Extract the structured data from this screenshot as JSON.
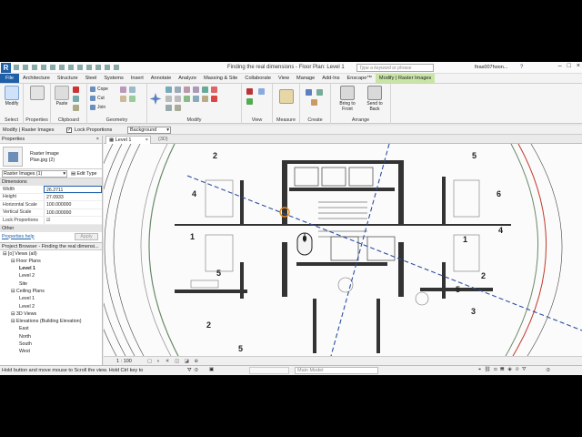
{
  "app": {
    "logo": "R",
    "title": "Finding the real dimensions - Floor Plan: Level 1",
    "search_placeholder": "Type a keyword or phrase",
    "user": "firas007hoon...",
    "help": "?"
  },
  "tabs": [
    "File",
    "Architecture",
    "Structure",
    "Steel",
    "Systems",
    "Insert",
    "Annotate",
    "Analyze",
    "Massing & Site",
    "Collaborate",
    "View",
    "Manage",
    "Add-Ins",
    "Enscape™",
    "Modify | Raster Images"
  ],
  "ribbon": {
    "select_label": "Select",
    "modify_label": "Modify",
    "properties_label": "Properties",
    "paste_label": "Paste",
    "clipboard_label": "Clipboard",
    "cope_label": "Cope",
    "cut_label": "Cut",
    "join_label": "Join",
    "geometry_label": "Geometry",
    "modify_panel_label": "Modify",
    "view_label": "View",
    "measure_label": "Measure",
    "create_label": "Create",
    "bring_front_label": "Bring to Front",
    "send_back_label": "Send to Back",
    "arrange_label": "Arrange"
  },
  "options_bar": {
    "context": "Modify | Raster Images",
    "lock_label": "Lock Proportions",
    "background_value": "Background"
  },
  "properties": {
    "title": "Properties",
    "type_name": "Raster Image",
    "type_file": "Plan.jpg (2)",
    "selector": "Raster Images (1)",
    "edit_type": "Edit Type",
    "section_dimensions": "Dimensions",
    "rows": [
      {
        "key": "Width",
        "value": "26.2711"
      },
      {
        "key": "Height",
        "value": "27.0933"
      },
      {
        "key": "Horizontal Scale",
        "value": "100.000000"
      },
      {
        "key": "Vertical Scale",
        "value": "100.000000"
      },
      {
        "key": "Lock Proportions",
        "value": "☑"
      }
    ],
    "section_other": "Other",
    "help_link": "Properties help",
    "apply": "Apply"
  },
  "browser": {
    "title": "Project Browser - Finding the real dimensi...",
    "items": [
      {
        "label": "[o] Views (all)",
        "indent": 0
      },
      {
        "label": "Floor Plans",
        "indent": 1
      },
      {
        "label": "Level 1",
        "indent": 2,
        "bold": true
      },
      {
        "label": "Level 2",
        "indent": 2
      },
      {
        "label": "Site",
        "indent": 2
      },
      {
        "label": "Ceiling Plans",
        "indent": 1
      },
      {
        "label": "Level 1",
        "indent": 2
      },
      {
        "label": "Level 2",
        "indent": 2
      },
      {
        "label": "3D Views",
        "indent": 1
      },
      {
        "label": "Elevations (Building Elevation)",
        "indent": 1
      },
      {
        "label": "East",
        "indent": 2
      },
      {
        "label": "North",
        "indent": 2
      },
      {
        "label": "South",
        "indent": 2
      },
      {
        "label": "West",
        "indent": 2
      }
    ]
  },
  "view": {
    "tab_label": "Level 1",
    "tab_3d": "{3D}",
    "scale": "1 : 100",
    "room_numbers": [
      "2",
      "5",
      "4",
      "6",
      "1",
      "4",
      "5",
      "2",
      "1",
      "5",
      "2",
      "3",
      "5"
    ]
  },
  "status": {
    "hint": "Hold button and move mouse to Scroll the view. Hold Ctrl key to",
    "counter": ":0",
    "model": "Main Model"
  },
  "colors": {
    "file_tab": "#1f5fa8",
    "context_tab": "#c9e5a6",
    "dashed_line": "#2c4fa0",
    "circle_marker": "#e08a1e"
  }
}
